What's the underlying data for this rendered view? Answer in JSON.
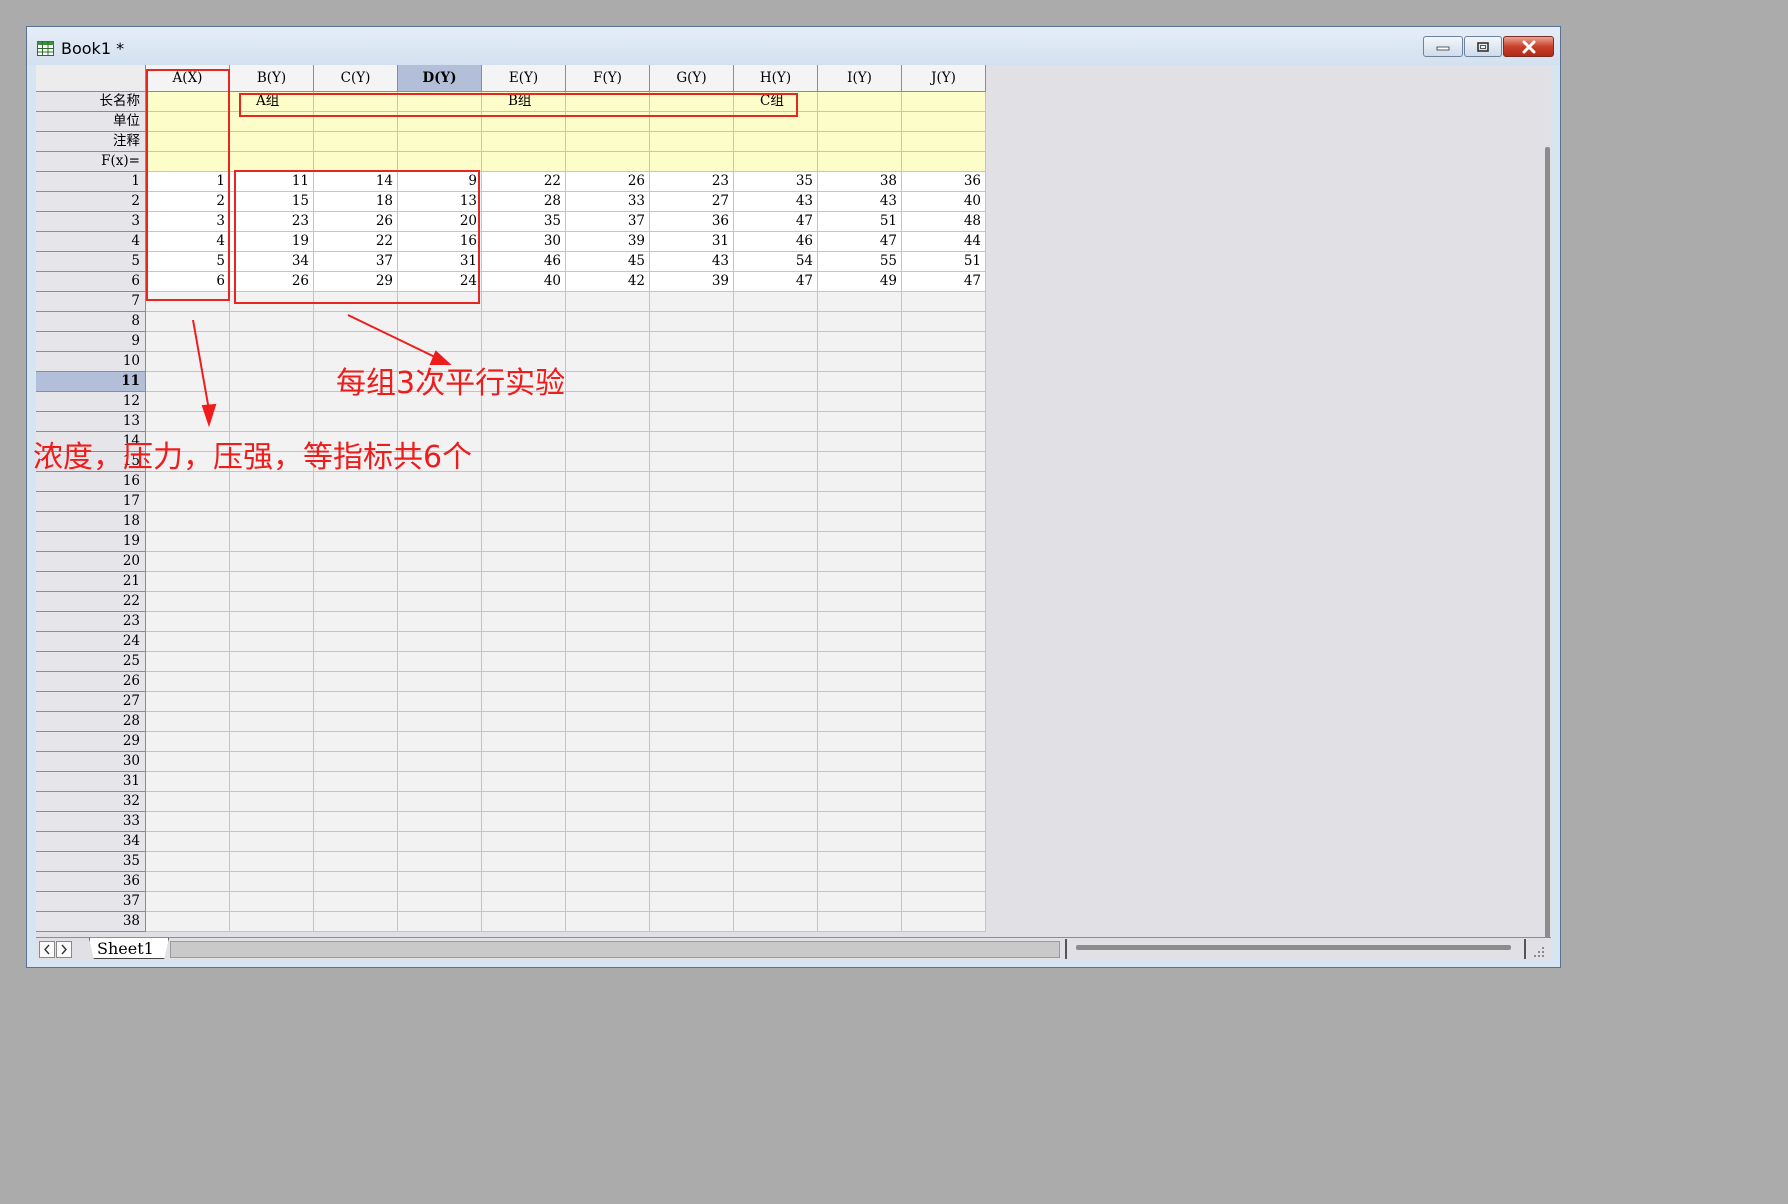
{
  "window": {
    "title": "Book1 *"
  },
  "sheet": {
    "row_header_labels": [
      "长名称",
      "单位",
      "注释",
      "F(x)="
    ],
    "columns": [
      {
        "header": "A(X)",
        "long_name": ""
      },
      {
        "header": "B(Y)",
        "long_name": "A组"
      },
      {
        "header": "C(Y)",
        "long_name": ""
      },
      {
        "header": "D(Y)",
        "long_name": ""
      },
      {
        "header": "E(Y)",
        "long_name": "B组"
      },
      {
        "header": "F(Y)",
        "long_name": ""
      },
      {
        "header": "G(Y)",
        "long_name": ""
      },
      {
        "header": "H(Y)",
        "long_name": "C组"
      },
      {
        "header": "I(Y)",
        "long_name": ""
      },
      {
        "header": "J(Y)",
        "long_name": ""
      }
    ],
    "selected_column": "D(Y)",
    "selected_row": "11",
    "data_rows": [
      [
        "1",
        "11",
        "14",
        "9",
        "22",
        "26",
        "23",
        "35",
        "38",
        "36"
      ],
      [
        "2",
        "15",
        "18",
        "13",
        "28",
        "33",
        "27",
        "43",
        "43",
        "40"
      ],
      [
        "3",
        "23",
        "26",
        "20",
        "35",
        "37",
        "36",
        "47",
        "51",
        "48"
      ],
      [
        "4",
        "19",
        "22",
        "16",
        "30",
        "39",
        "31",
        "46",
        "47",
        "44"
      ],
      [
        "5",
        "34",
        "37",
        "31",
        "46",
        "45",
        "43",
        "54",
        "55",
        "51"
      ],
      [
        "6",
        "26",
        "29",
        "24",
        "40",
        "42",
        "39",
        "47",
        "49",
        "47"
      ]
    ],
    "row_numbers": [
      "1",
      "2",
      "3",
      "4",
      "5",
      "6",
      "7",
      "8",
      "9",
      "10",
      "11",
      "12",
      "13",
      "14",
      "15",
      "16",
      "17",
      "18",
      "19",
      "20",
      "21",
      "22",
      "23",
      "24",
      "25",
      "26",
      "27",
      "28",
      "29",
      "30",
      "31",
      "32",
      "33",
      "34",
      "35",
      "36",
      "37",
      "38"
    ],
    "tab_label": "Sheet1"
  },
  "annotations": {
    "replicates": "每组3次平行实验",
    "indicators": "浓度，压力，压强，等指标共6个",
    "color": "#ef1c1c"
  },
  "icons": {
    "app": "worksheet-icon",
    "minimize": "minimize-icon",
    "maximize": "restore-icon",
    "close": "close-icon"
  }
}
